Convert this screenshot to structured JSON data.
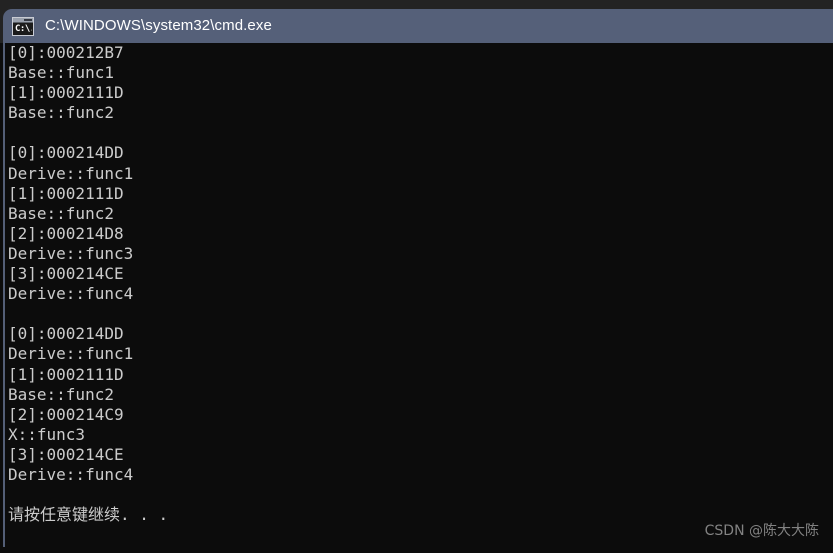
{
  "window": {
    "title": "C:\\WINDOWS\\system32\\cmd.exe",
    "icon": "cmd-icon",
    "icon_text": "C:\\.",
    "titlebar_color": "#556079",
    "console_bg": "#0c0c0c",
    "console_fg": "#cccccc"
  },
  "console": {
    "lines": [
      "[0]:000212B7",
      "Base::func1",
      "[1]:0002111D",
      "Base::func2",
      "",
      "[0]:000214DD",
      "Derive::func1",
      "[1]:0002111D",
      "Base::func2",
      "[2]:000214D8",
      "Derive::func3",
      "[3]:000214CE",
      "Derive::func4",
      "",
      "[0]:000214DD",
      "Derive::func1",
      "[1]:0002111D",
      "Base::func2",
      "[2]:000214C9",
      "X::func3",
      "[3]:000214CE",
      "Derive::func4",
      "",
      "请按任意键继续. . ."
    ]
  },
  "watermark": {
    "text": "CSDN @陈大大陈"
  }
}
